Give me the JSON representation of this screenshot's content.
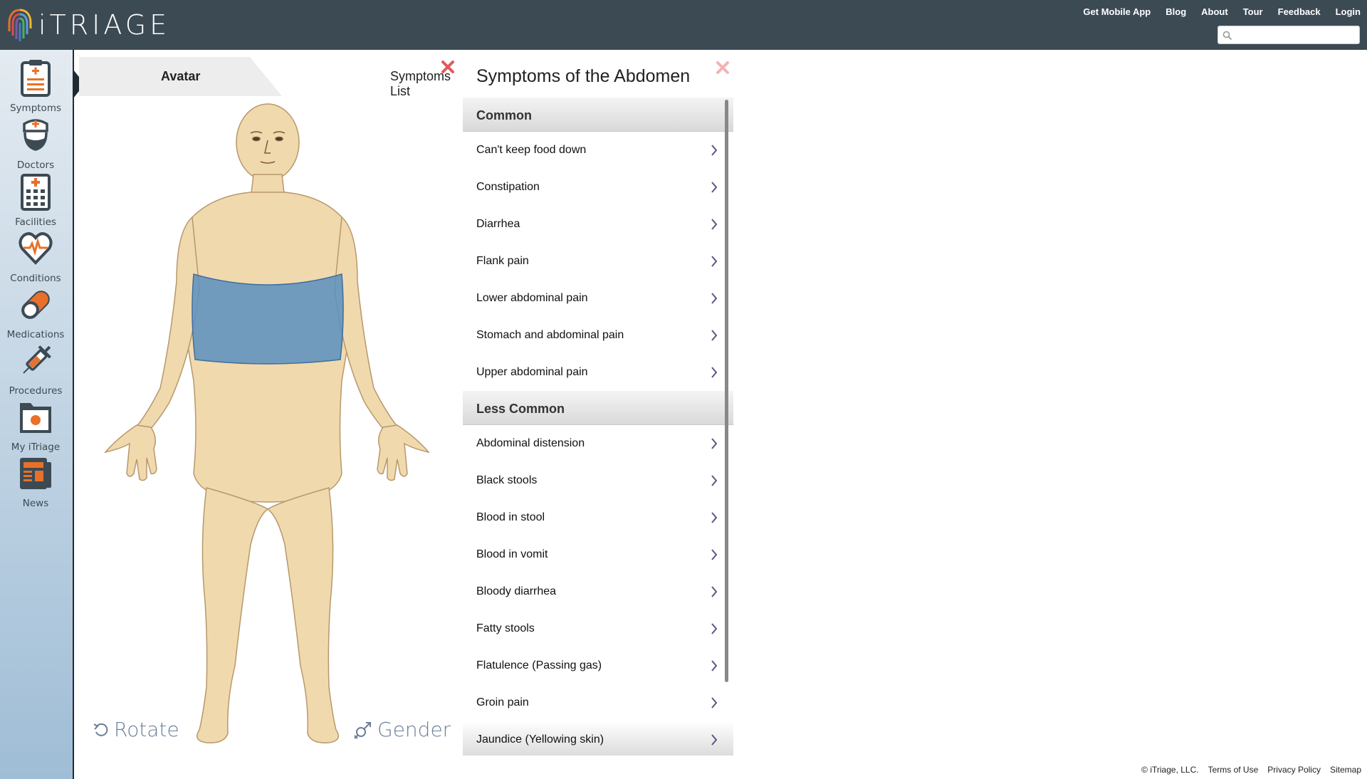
{
  "header": {
    "logo_text": "iTRIAGE",
    "nav": [
      "Get Mobile App",
      "Blog",
      "About",
      "Tour",
      "Feedback",
      "Login"
    ],
    "search_placeholder": ""
  },
  "sidebar": {
    "items": [
      {
        "label": "Symptoms",
        "icon": "clipboard-icon"
      },
      {
        "label": "Doctors",
        "icon": "doctor-icon"
      },
      {
        "label": "Facilities",
        "icon": "hospital-icon"
      },
      {
        "label": "Conditions",
        "icon": "heart-icon"
      },
      {
        "label": "Medications",
        "icon": "pill-icon"
      },
      {
        "label": "Procedures",
        "icon": "syringe-icon"
      },
      {
        "label": "My iTriage",
        "icon": "folder-icon"
      },
      {
        "label": "News",
        "icon": "newspaper-icon"
      }
    ]
  },
  "avatar_panel": {
    "tabs": {
      "avatar": "Avatar",
      "symptoms_list": "Symptoms List"
    },
    "rotate_label": "Rotate",
    "gender_label": "Gender"
  },
  "symptoms_panel": {
    "title": "Symptoms of the Abdomen",
    "sections": [
      {
        "heading": "Common",
        "items": [
          "Can't keep food down",
          "Constipation",
          "Diarrhea",
          "Flank pain",
          "Lower abdominal pain",
          "Stomach and abdominal pain",
          "Upper abdominal pain"
        ]
      },
      {
        "heading": "Less Common",
        "items": [
          "Abdominal distension",
          "Black stools",
          "Blood in stool",
          "Blood in vomit",
          "Bloody diarrhea",
          "Fatty stools",
          "Flatulence (Passing gas)",
          "Groin pain",
          "Jaundice (Yellowing skin)"
        ]
      }
    ]
  },
  "footer": {
    "copyright": "© iTriage, LLC.",
    "links": [
      "Terms of Use",
      "Privacy Policy",
      "Sitemap"
    ]
  },
  "colors": {
    "header_bg": "#3c4a54",
    "accent_orange": "#e8702a",
    "highlight_blue": "#5b8fbf",
    "skin": "#f1d9ae",
    "close_red": "#e05a5a"
  }
}
